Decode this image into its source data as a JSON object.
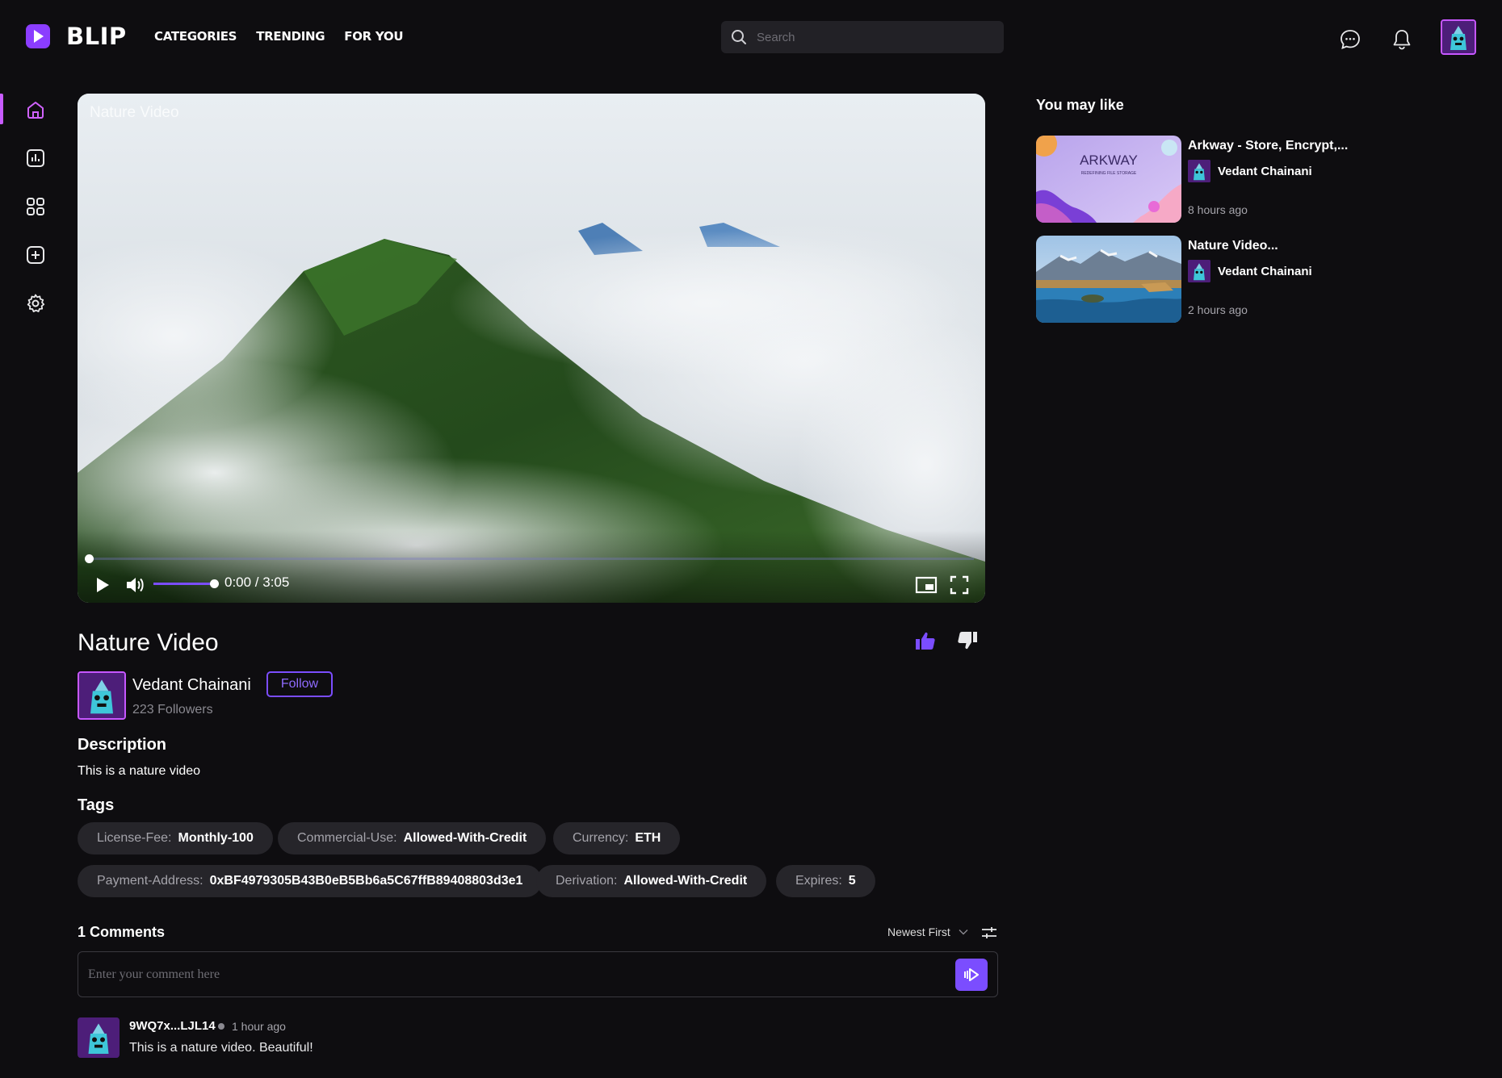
{
  "brand": {
    "name": "BLIP",
    "accent": "#7b4dff"
  },
  "nav": {
    "items": [
      "CATEGORIES",
      "TRENDING",
      "FOR YOU"
    ]
  },
  "search": {
    "placeholder": "Search"
  },
  "top_icons": [
    "chat-icon",
    "bell-icon",
    "avatar"
  ],
  "sidebar": {
    "items": [
      "home-icon",
      "analytics-icon",
      "grid-icon",
      "add-icon",
      "settings-icon"
    ],
    "active": "home-icon"
  },
  "video": {
    "overlay_label": "Nature Video",
    "time": "0:00 / 3:05",
    "progress": 0,
    "volume": 0.85
  },
  "details": {
    "title": "Nature Video",
    "author": "Vedant Chainani",
    "followers": "223 Followers",
    "follow_label": "Follow",
    "description_heading": "Description",
    "description": "This is a nature video",
    "tags_heading": "Tags",
    "tags": [
      {
        "key": "License-Fee:",
        "value": "Monthly-100"
      },
      {
        "key": "Commercial-Use:",
        "value": "Allowed-With-Credit"
      },
      {
        "key": "Currency:",
        "value": "ETH"
      },
      {
        "key": "Payment-Address:",
        "value": "0xBF4979305B43B0eB5Bb6a5C67ffB89408803d3e1"
      },
      {
        "key": "Derivation:",
        "value": "Allowed-With-Credit"
      },
      {
        "key": "Expires:",
        "value": "5"
      }
    ]
  },
  "comments": {
    "heading": "1 Comments",
    "sort": "Newest First",
    "placeholder": "Enter your comment here",
    "items": [
      {
        "user": "9WQ7x...LJL14",
        "time": "1 hour ago",
        "text": "This is a nature video. Beautiful!"
      }
    ]
  },
  "recommendations": {
    "heading": "You may like",
    "items": [
      {
        "title": "Arkway - Store, Encrypt,...",
        "author": "Vedant Chainani",
        "time": "8 hours ago",
        "thumb_text": "ARKWAY",
        "thumb_sub": "REDEFINING FILE STORAGE"
      },
      {
        "title": "Nature Video...",
        "author": "Vedant Chainani",
        "time": "2 hours ago"
      }
    ]
  }
}
